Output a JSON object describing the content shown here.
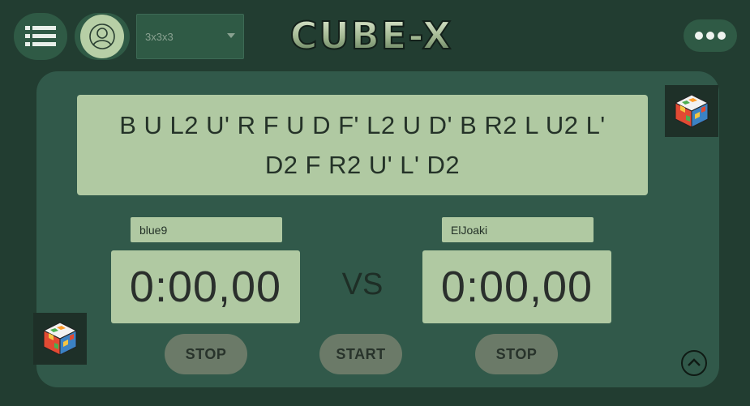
{
  "header": {
    "logo_text": "CUBE-X",
    "puzzle_select": {
      "value": "3x3x3"
    }
  },
  "scramble": {
    "text": "B U L2 U' R F U D F' L2 U D' B R2 L U2 L' D2 F R2 U' L' D2"
  },
  "players": [
    {
      "name": "blue9",
      "time": "0:00,00",
      "stop_label": "STOP"
    },
    {
      "name": "ElJoaki",
      "time": "0:00,00",
      "stop_label": "STOP"
    }
  ],
  "vs_label": "VS",
  "start_label": "START",
  "colors": {
    "background": "#223d31",
    "panel": "#31594a",
    "surface_light": "#b0c9a2",
    "button": "#6b7a68"
  },
  "icons": {
    "menu": "list-icon",
    "user": "user-icon",
    "more": "more-horizontal-icon",
    "cube": "rubiks-cube-icon",
    "up": "chevron-up-circle-icon"
  }
}
